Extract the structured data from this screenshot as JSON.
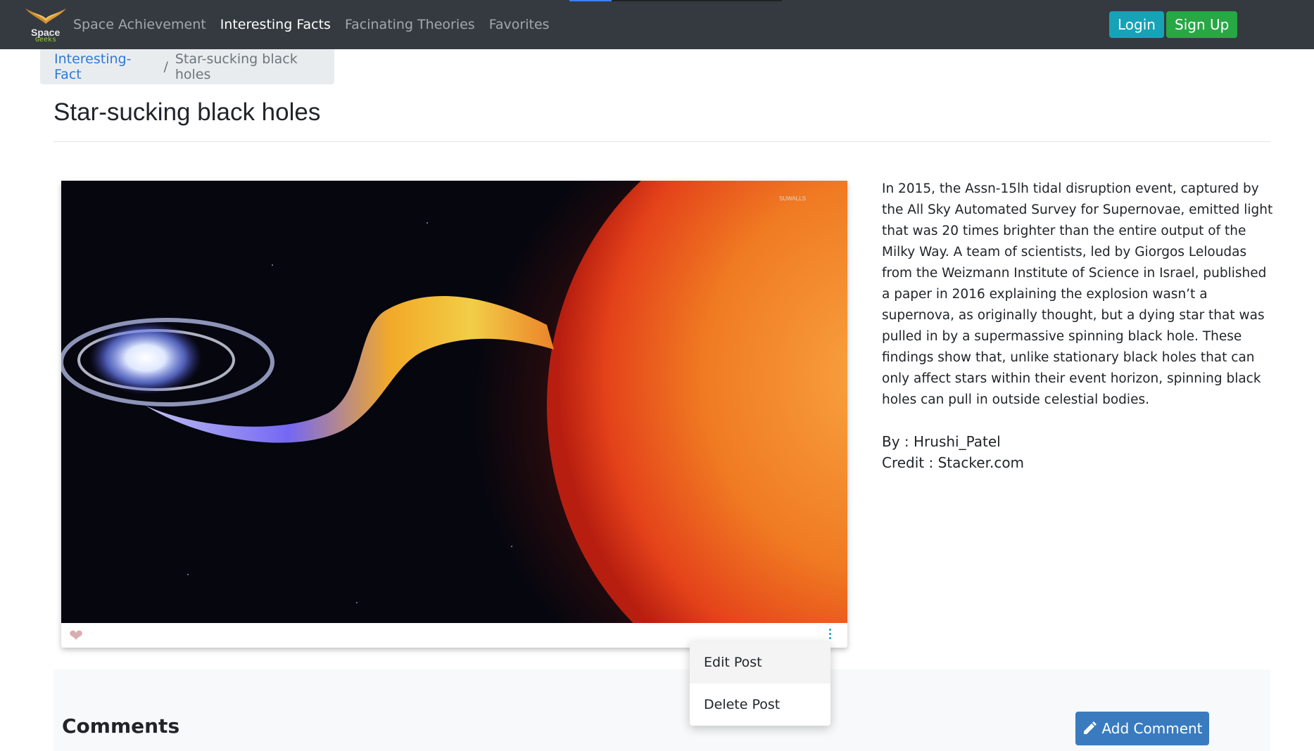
{
  "brand": {
    "line1": "Space",
    "line2": "Geeks"
  },
  "nav": {
    "items": [
      {
        "label": "Space Achievement",
        "active": false
      },
      {
        "label": "Interesting Facts",
        "active": true
      },
      {
        "label": "Facinating Theories",
        "active": false
      },
      {
        "label": "Favorites",
        "active": false
      }
    ],
    "login_label": "Login",
    "signup_label": "Sign Up"
  },
  "breadcrumb": {
    "parent": "Interesting-Fact",
    "separator": "/",
    "current": "Star-sucking black holes"
  },
  "post": {
    "title": "Star-sucking black holes",
    "image_watermark": "SUWALLS",
    "description": "In 2015, the Assn-15lh tidal disruption event, captured by the All Sky Automated Survey for Supernovae, emitted light that was 20 times brighter than the entire output of the Milky Way. A team of scientists, led by Giorgos Leloudas from the Weizmann Institute of Science in Israel, published a paper in 2016 explaining the explosion wasn’t a supernova, as originally thought, but a dying star that was pulled in by a supermassive spinning black hole. These findings show that, unlike stationary black holes that can only affect stars within their event horizon, spinning black holes can pull in outside celestial bodies.",
    "by_label": "By : ",
    "author": "Hrushi_Patel",
    "credit_label": "Credit : ",
    "credit": "Stacker.com"
  },
  "post_menu": {
    "edit_label": "Edit Post",
    "delete_label": "Delete Post"
  },
  "comments": {
    "heading": "Comments",
    "add_label": "Add Comment"
  },
  "colors": {
    "navbar": "#343a40",
    "login": "#17a2b8",
    "signup": "#28a745",
    "link": "#2d7ad6",
    "add_comment": "#3a7bbf"
  },
  "icons": {
    "like": "heart-icon",
    "menu": "kebab-menu-icon",
    "add_comment": "pencil-icon"
  }
}
